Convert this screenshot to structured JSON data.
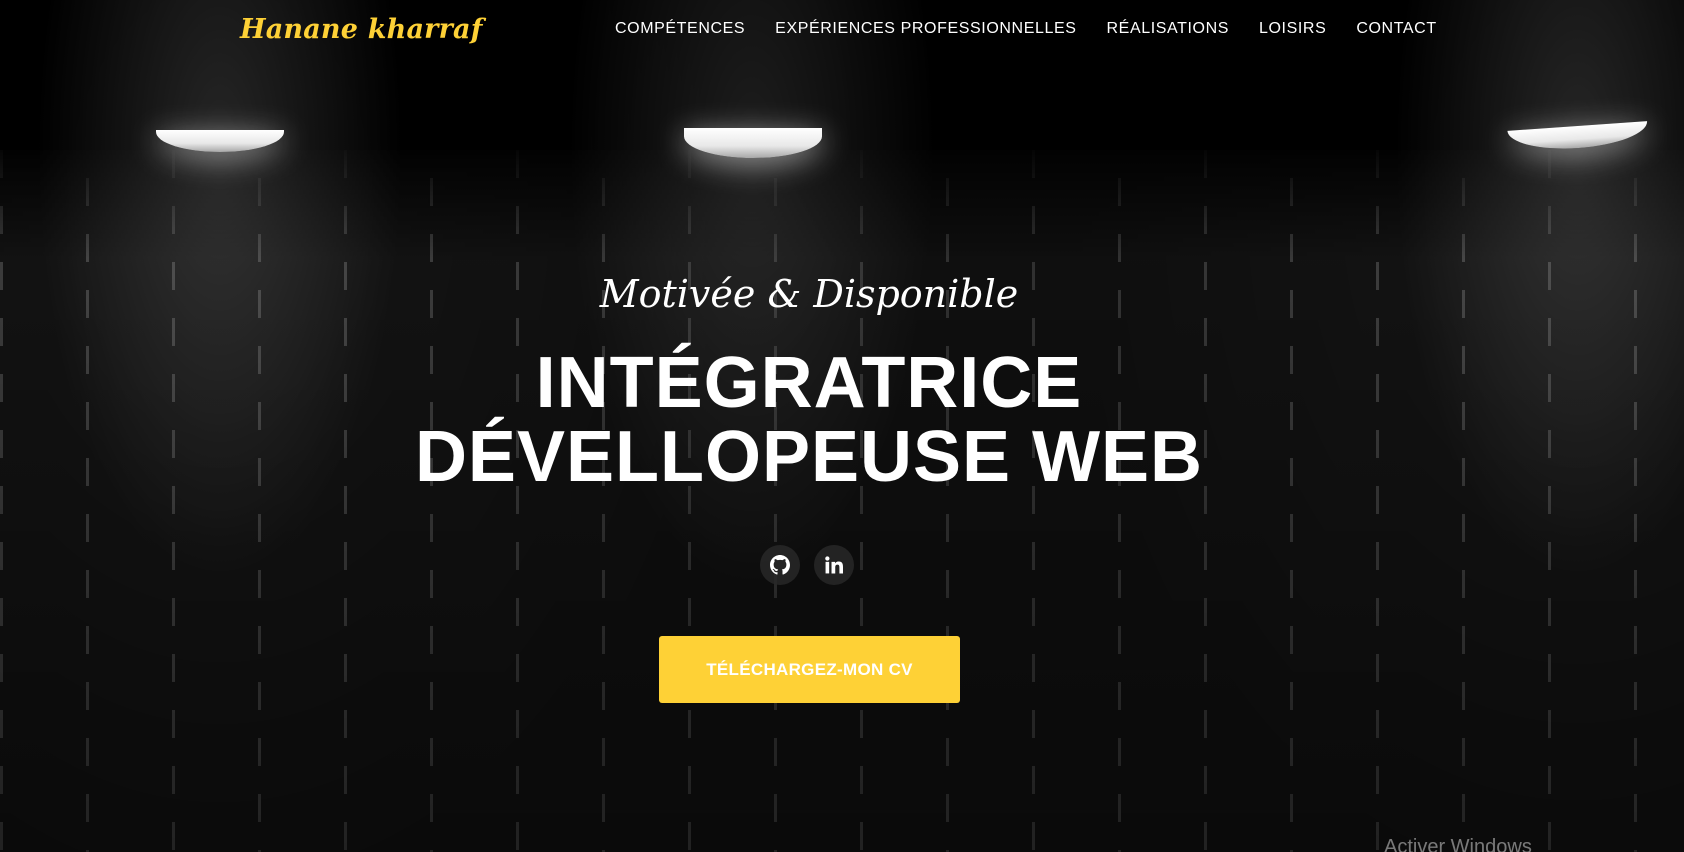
{
  "navbar": {
    "brand": "Hanane kharraf",
    "links": [
      {
        "label": "COMPÉTENCES"
      },
      {
        "label": "EXPÉRIENCES PROFESSIONNELLES"
      },
      {
        "label": "RÉALISATIONS"
      },
      {
        "label": "LOISIRS"
      },
      {
        "label": "CONTACT"
      }
    ]
  },
  "hero": {
    "subheading": "Motivée & Disponible",
    "heading_line1": "INTÉGRATRICE",
    "heading_line2": "DÉVELLOPEUSE WEB",
    "socials": [
      {
        "icon": "github-icon"
      },
      {
        "icon": "linkedin-icon"
      }
    ],
    "cv_button": "TÉLÉCHARGEZ-MON CV"
  },
  "system": {
    "watermark": "Activer Windows"
  },
  "colors": {
    "accent": "#fed136",
    "text": "#ffffff",
    "background": "#000000"
  }
}
